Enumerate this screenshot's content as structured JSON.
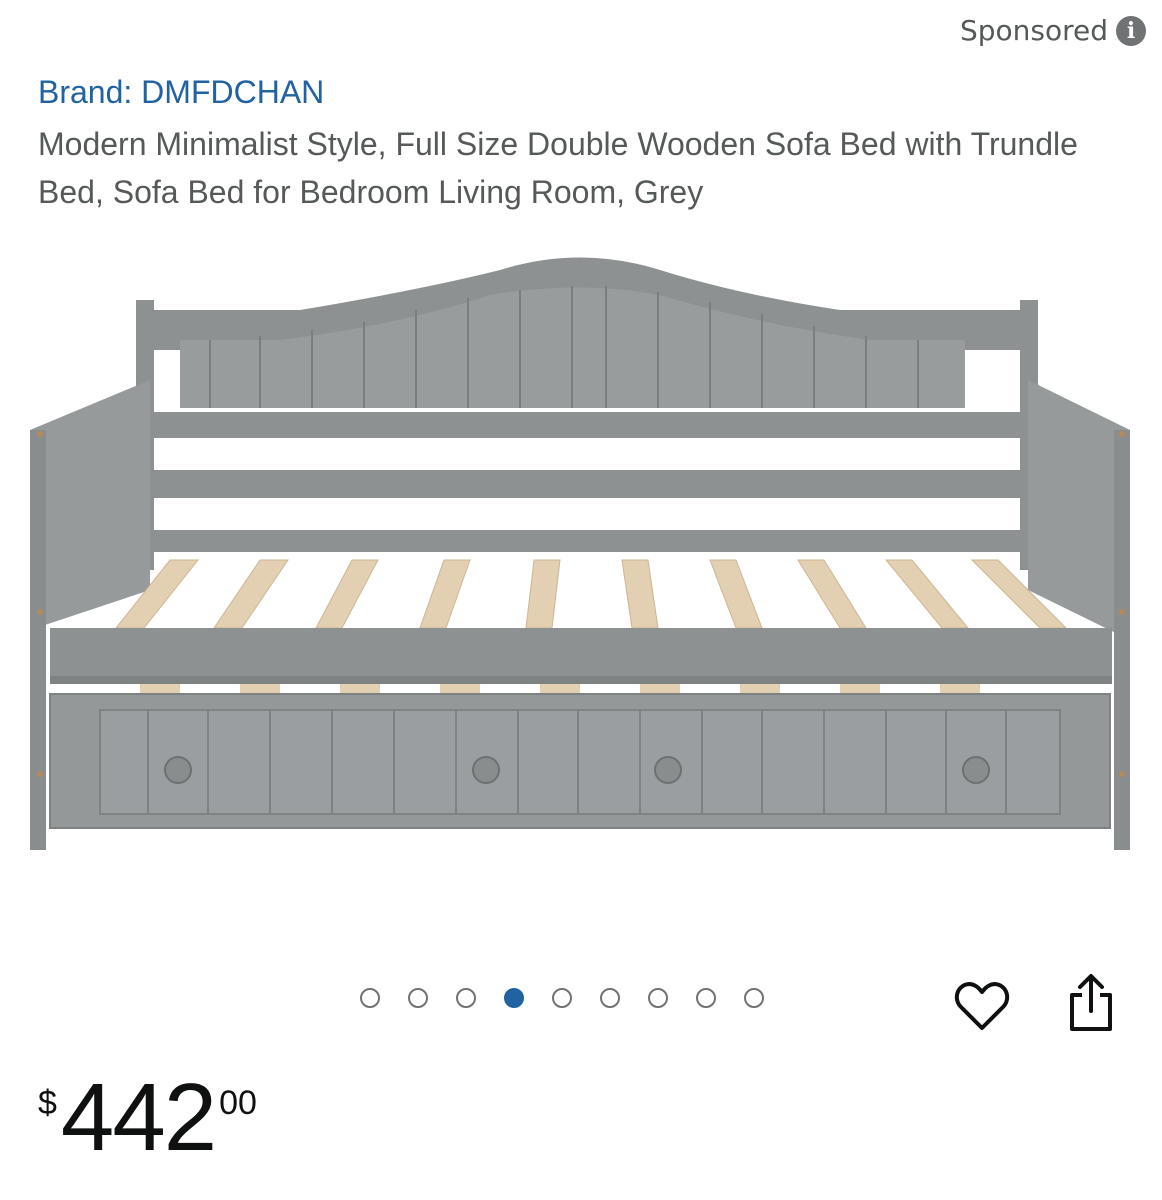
{
  "sponsored": {
    "label": "Sponsored",
    "icon": "info-icon",
    "icon_glyph": "i"
  },
  "product": {
    "brand": "Brand: DMFDCHAN",
    "title": "Modern Minimalist Style, Full Size Double Wooden Sofa Bed with Trundle Bed, Sofa Bed for Bedroom Living Room, Grey",
    "image_alt": "Grey wooden daybed with trundle"
  },
  "carousel": {
    "total": 9,
    "active_index": 3
  },
  "actions": {
    "favorite_icon": "heart-icon",
    "share_icon": "share-icon"
  },
  "price": {
    "symbol": "$",
    "whole": "442",
    "fraction": "00"
  },
  "colors": {
    "link": "#2162a1",
    "text_secondary": "#565959",
    "price": "#0f1111",
    "frame": "#8e9192",
    "slats": "#e3cfb2"
  }
}
